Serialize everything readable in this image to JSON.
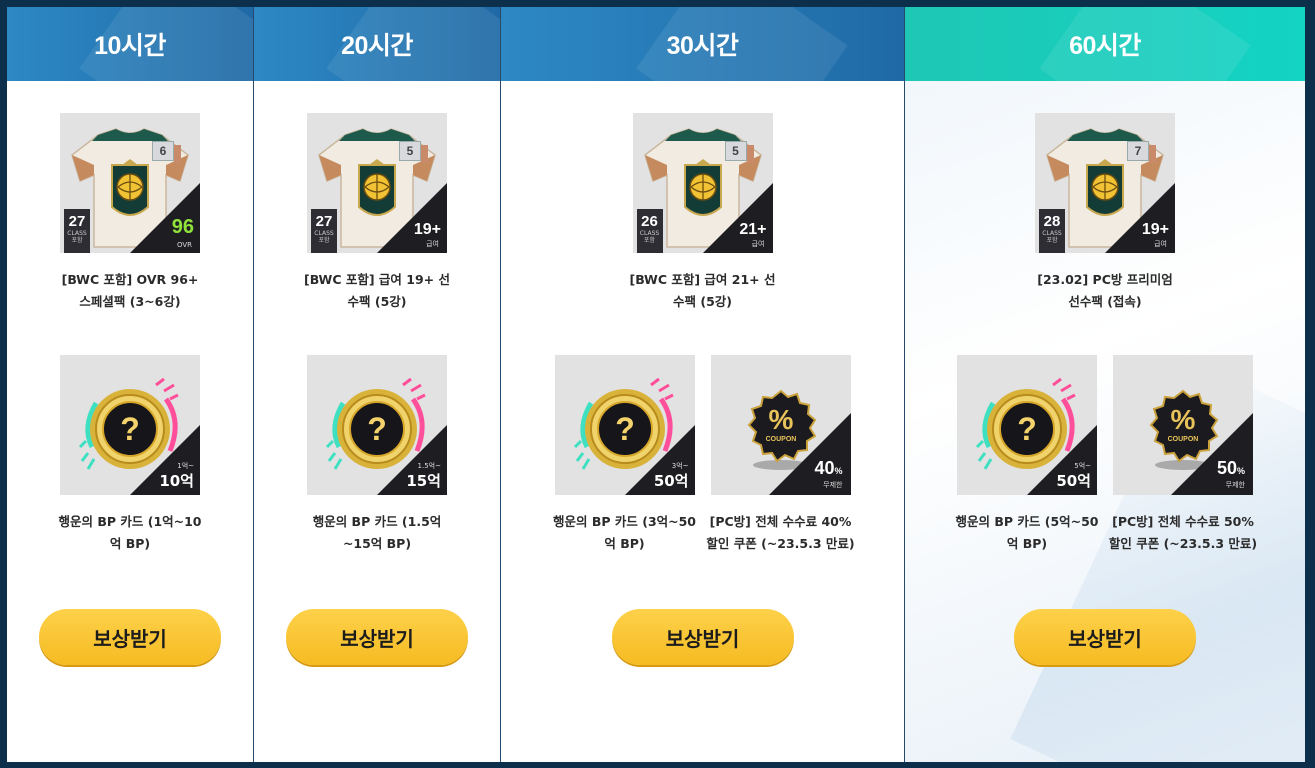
{
  "columns": [
    {
      "title": "10시간",
      "top_items": [
        {
          "type": "player-pack",
          "level": "27",
          "class_label": "CLASS",
          "class_sub": "포함",
          "grade": "6",
          "value": "96",
          "value_label": "OVR",
          "green": true,
          "caption": "[BWC 포함] OVR 96+ 스페셜팩 (3~6강)"
        }
      ],
      "bottom_items": [
        {
          "type": "bp-card",
          "range_small": "1억~",
          "range": "10억",
          "caption": "행운의 BP 카드 (1억~10억 BP)"
        }
      ],
      "button": "보상받기"
    },
    {
      "title": "20시간",
      "top_items": [
        {
          "type": "player-pack",
          "level": "27",
          "class_label": "CLASS",
          "class_sub": "포함",
          "grade": "5",
          "value": "19+",
          "value_label": "급여",
          "green": false,
          "caption": "[BWC 포함] 급여 19+ 선수팩 (5강)"
        }
      ],
      "bottom_items": [
        {
          "type": "bp-card",
          "range_small": "1.5억~",
          "range": "15억",
          "caption": "행운의 BP 카드 (1.5억~15억 BP)"
        }
      ],
      "button": "보상받기"
    },
    {
      "title": "30시간",
      "top_items": [
        {
          "type": "player-pack",
          "level": "26",
          "class_label": "CLASS",
          "class_sub": "포함",
          "grade": "5",
          "value": "21+",
          "value_label": "급여",
          "green": false,
          "caption": "[BWC 포함] 급여 21+ 선수팩 (5강)"
        }
      ],
      "bottom_items": [
        {
          "type": "bp-card",
          "range_small": "3억~",
          "range": "50억",
          "caption": "행운의 BP 카드 (3억~50억 BP)"
        },
        {
          "type": "coupon",
          "percent": "40",
          "sub": "무제한",
          "caption": "[PC방] 전체 수수료 40% 할인 쿠폰 (~23.5.3 만료)"
        }
      ],
      "button": "보상받기"
    },
    {
      "title": "60시간",
      "top_items": [
        {
          "type": "player-pack",
          "level": "28",
          "class_label": "CLASS",
          "class_sub": "포함",
          "grade": "7",
          "value": "19+",
          "value_label": "급여",
          "green": false,
          "caption": "[23.02] PC방 프리미엄 선수팩 (접속)"
        }
      ],
      "bottom_items": [
        {
          "type": "bp-card",
          "range_small": "5억~",
          "range": "50억",
          "caption": "행운의 BP 카드 (5억~50억 BP)"
        },
        {
          "type": "coupon",
          "percent": "50",
          "sub": "무제한",
          "caption": "[PC방] 전체 수수료 50% 할인 쿠폰 (~23.5.3 만료)"
        }
      ],
      "button": "보상받기"
    }
  ],
  "coupon_word": "COUPON",
  "percent_symbol": "%",
  "colors": {
    "header_blue": "#2d88c4",
    "header_teal": "#13d3c3",
    "button_yellow": "#f9c632",
    "frame": "#0c2f4b"
  }
}
